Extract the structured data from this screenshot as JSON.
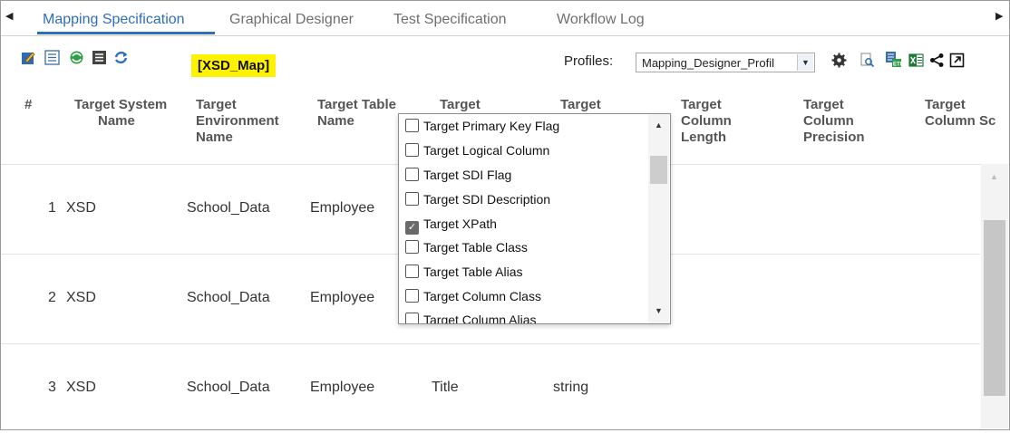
{
  "tabs": {
    "items": [
      "Mapping Specification",
      "Graphical Designer",
      "Test Specification",
      "Workflow Log"
    ],
    "active": "Mapping Specification"
  },
  "toolbar": {
    "icons": [
      "edit-icon",
      "import-icon",
      "sync-icon",
      "list-icon",
      "refresh-icon",
      "settings-icon",
      "preview-icon",
      "etl-icon",
      "excel-icon",
      "share-icon",
      "expand-icon"
    ],
    "map_name": "[XSD_Map]",
    "profiles_label": "Profiles:",
    "profile_value": "Mapping_Designer_Profil"
  },
  "table": {
    "headers": {
      "num": "#",
      "system_name": [
        "Target System",
        "Name"
      ],
      "environment": [
        "Target",
        "Environment",
        "Name"
      ],
      "table_name": [
        "Target Table",
        "Name"
      ],
      "col4": [
        "Target"
      ],
      "col5": [
        "Target"
      ],
      "length": [
        "Target",
        "Column",
        "Length"
      ],
      "precision": [
        "Target",
        "Column",
        "Precision"
      ],
      "col_sc": [
        "Target",
        "Column Sc"
      ]
    },
    "rows": [
      {
        "num": "1",
        "system": "XSD",
        "env": "School_Data",
        "table": "Employee",
        "c4": "",
        "c5": ""
      },
      {
        "num": "2",
        "system": "XSD",
        "env": "School_Data",
        "table": "Employee",
        "c4": "",
        "c5": ""
      },
      {
        "num": "3",
        "system": "XSD",
        "env": "School_Data",
        "table": "Employee",
        "c4": "Title",
        "c5": "string"
      }
    ]
  },
  "column_chooser": {
    "options": [
      {
        "label": "Target Primary Key Flag",
        "checked": false
      },
      {
        "label": "Target Logical Column",
        "checked": false
      },
      {
        "label": "Target SDI Flag",
        "checked": false
      },
      {
        "label": "Target SDI Description",
        "checked": false
      },
      {
        "label": "Target XPath",
        "checked": true
      },
      {
        "label": "Target Table Class",
        "checked": false
      },
      {
        "label": "Target Table Alias",
        "checked": false
      },
      {
        "label": "Target Column Class",
        "checked": false
      },
      {
        "label": "Target Column Alias",
        "checked": false
      }
    ]
  },
  "colors": {
    "accent": "#2f6fb7",
    "highlight": "#fff200"
  }
}
